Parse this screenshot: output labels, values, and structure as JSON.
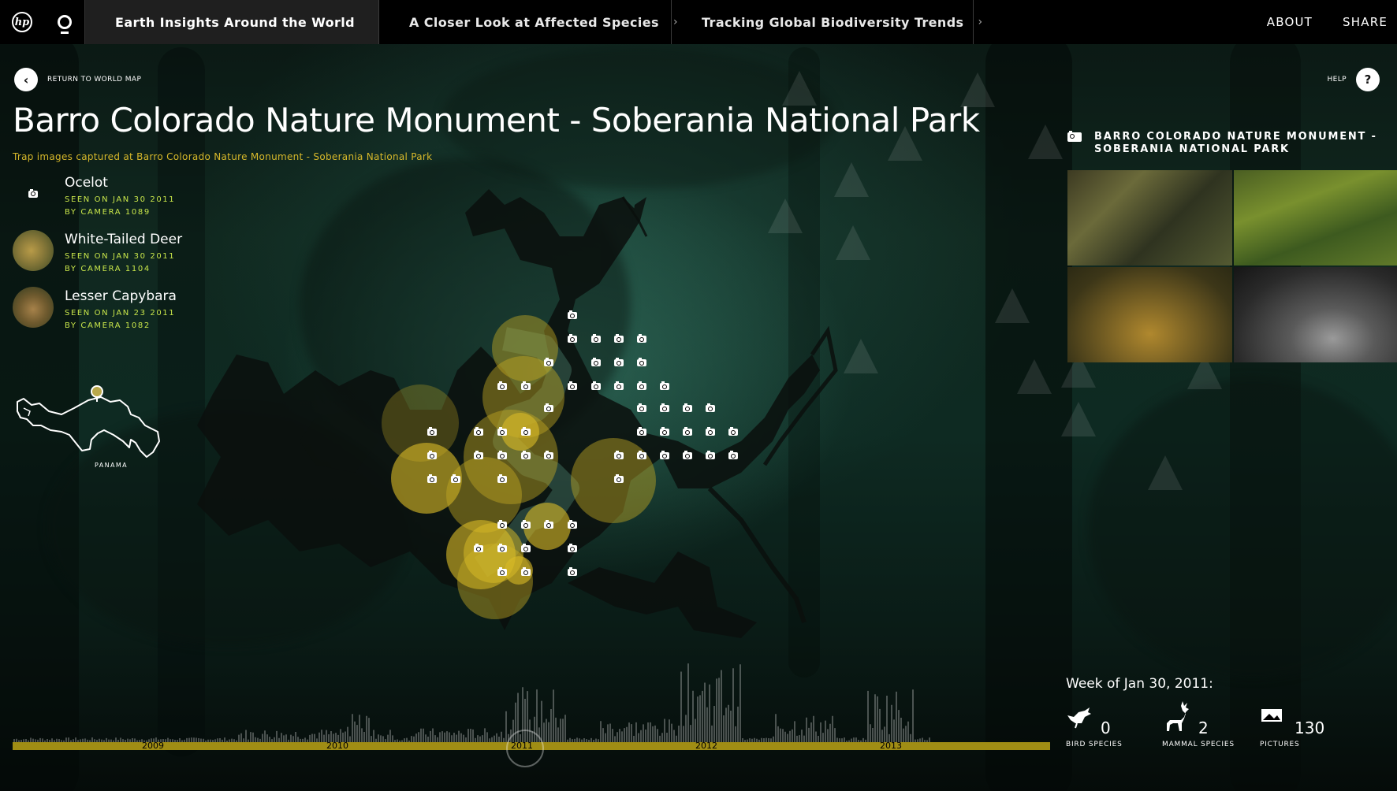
{
  "nav": {
    "tabs": [
      {
        "label": "Earth Insights Around the World",
        "active": true
      },
      {
        "label": "A Closer Look at Affected Species",
        "active": false
      },
      {
        "label": "Tracking Global Biodiversity Trends",
        "active": false
      }
    ],
    "about": "ABOUT",
    "share": "SHARE",
    "chevron": "›"
  },
  "header": {
    "back_label": "RETURN TO WORLD MAP",
    "help_label": "HELP",
    "help_glyph": "?",
    "back_glyph": "‹",
    "title": "Barro Colorado Nature Monument - Soberania National Park",
    "subtitle": "Trap images captured at Barro Colorado Nature Monument - Soberania National Park"
  },
  "sightings": [
    {
      "name": "Ocelot",
      "seen": "SEEN ON JAN 30 2011",
      "camera": "BY CAMERA 1089"
    },
    {
      "name": "White-Tailed Deer",
      "seen": "SEEN ON JAN 30 2011",
      "camera": "BY CAMERA 1104"
    },
    {
      "name": "Lesser Capybara",
      "seen": "SEEN ON JAN 23 2011",
      "camera": "BY CAMERA 1082"
    }
  ],
  "minimap": {
    "label": "PANAMA"
  },
  "right_panel": {
    "title_line1": "BARRO COLORADO NATURE MONUMENT -",
    "title_line2": "SOBERANIA NATIONAL PARK"
  },
  "stats": {
    "week_label": "Week of Jan 30, 2011:",
    "bird": {
      "value": "0",
      "label": "BIRD SPECIES"
    },
    "mammal": {
      "value": "2",
      "label": "MAMMAL SPECIES"
    },
    "pictures": {
      "value": "130",
      "label": "PICTURES"
    }
  },
  "timeline": {
    "years": [
      "2009",
      "2010",
      "2011",
      "2012",
      "2013"
    ]
  },
  "colors": {
    "accent_yellow": "#d7b82a",
    "meta_green": "#c9e64a",
    "timeline_bar": "#a08d14"
  }
}
